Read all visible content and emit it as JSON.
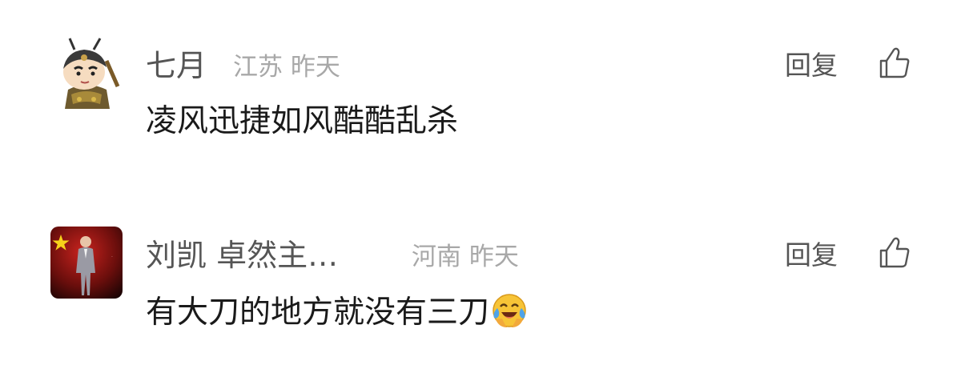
{
  "comments": [
    {
      "username": "七月",
      "location": "江苏",
      "time": "昨天",
      "text": "凌风迅捷如风酷酷乱杀",
      "reply_label": "回复",
      "avatar_icon": "crayon-shin-chan-warrior-avatar",
      "like_icon": "thumbs-up-icon"
    },
    {
      "username": "刘凯 卓然主…",
      "location": "河南",
      "time": "昨天",
      "text": "有大刀的地方就没有三刀",
      "emoji": "face-with-tears-of-joy-emoji",
      "reply_label": "回复",
      "avatar_icon": "man-in-suit-red-star-avatar",
      "like_icon": "thumbs-up-icon"
    }
  ],
  "colors": {
    "username": "#555555",
    "meta": "#a8a8a8",
    "content": "#1a1a1a",
    "background": "#ffffff"
  }
}
